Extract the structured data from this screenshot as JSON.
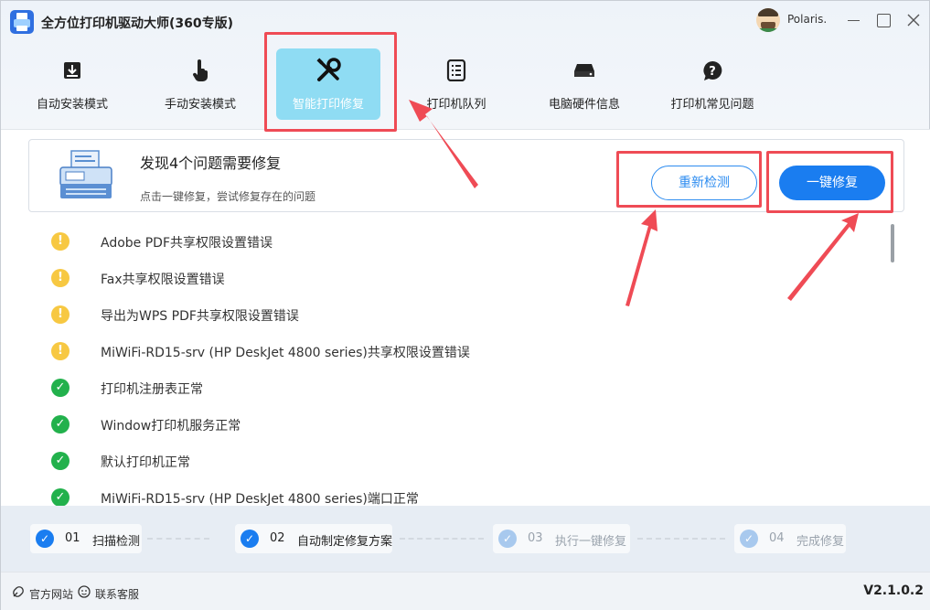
{
  "window": {
    "title": "全方位打印机驱动大师(360专版)",
    "user_name": "Polaris."
  },
  "nav": {
    "tabs": [
      {
        "label": "自动安装模式",
        "icon": "download-box-icon",
        "active": false
      },
      {
        "label": "手动安装模式",
        "icon": "hand-pointer-icon",
        "active": false
      },
      {
        "label": "智能打印修复",
        "icon": "tools-icon",
        "active": true
      },
      {
        "label": "打印机队列",
        "icon": "list-icon",
        "active": false
      },
      {
        "label": "电脑硬件信息",
        "icon": "hard-drive-icon",
        "active": false
      },
      {
        "label": "打印机常见问题",
        "icon": "question-bubble-icon",
        "active": false
      }
    ]
  },
  "banner": {
    "title": "发现4个问题需要修复",
    "subtitle": "点击一键修复，尝试修复存在的问题",
    "recheck_label": "重新检测",
    "repair_label": "一键修复"
  },
  "issues": [
    {
      "status": "warning",
      "text": "Adobe PDF共享权限设置错误"
    },
    {
      "status": "warning",
      "text": "Fax共享权限设置错误"
    },
    {
      "status": "warning",
      "text": "导出为WPS PDF共享权限设置错误"
    },
    {
      "status": "warning",
      "text": "MiWiFi-RD15-srv (HP DeskJet 4800 series)共享权限设置错误"
    },
    {
      "status": "ok",
      "text": "打印机注册表正常"
    },
    {
      "status": "ok",
      "text": "Window打印机服务正常"
    },
    {
      "status": "ok",
      "text": "默认打印机正常"
    },
    {
      "status": "ok",
      "text": "MiWiFi-RD15-srv (HP DeskJet 4800 series)端口正常"
    }
  ],
  "steps": [
    {
      "num": "01",
      "label": "扫描检测",
      "done": true
    },
    {
      "num": "02",
      "label": "自动制定修复方案",
      "done": true
    },
    {
      "num": "03",
      "label": "执行一键修复",
      "done": false
    },
    {
      "num": "04",
      "label": "完成修复",
      "done": false
    }
  ],
  "footer": {
    "website_label": "官方网站",
    "support_label": "联系客服",
    "version": "V2.1.0.2"
  },
  "colors": {
    "accent": "#1a7df0",
    "active_tab": "#8fdcf3",
    "warning": "#f7c842",
    "ok": "#22b14c",
    "annotation": "#ef4b55"
  }
}
